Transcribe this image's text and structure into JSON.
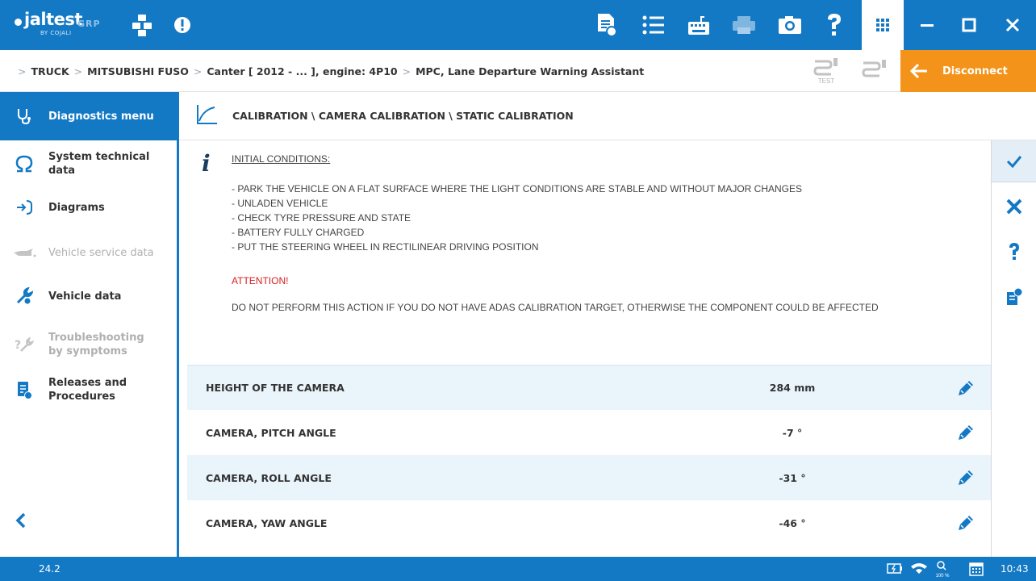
{
  "app": {
    "logo_text": "jaltest",
    "logo_sub": "BY COJALI",
    "grp_label": "GRP",
    "accent_color": "#1479c4",
    "orange_color": "#f39319"
  },
  "topbar": {
    "icons": [
      "car-group-icon",
      "alert-icon",
      "report-icon",
      "list-icon",
      "keyboard-icon",
      "printer-icon",
      "camera-icon",
      "help-icon",
      "apps-grid-icon",
      "minimize-icon",
      "maximize-icon",
      "close-icon"
    ]
  },
  "breadcrumb": {
    "items": [
      "TRUCK",
      "MITSUBISHI FUSO",
      "Canter [ 2012 - ... ], engine: 4P10",
      "MPC, Lane Departure Warning Assistant"
    ],
    "test_label": "TEST",
    "disconnect_label": "Disconnect"
  },
  "sidebar": {
    "items": [
      {
        "label": "Diagnostics menu",
        "icon": "stethoscope-icon",
        "state": "active"
      },
      {
        "label": "System technical data",
        "icon": "omega-icon",
        "state": "normal"
      },
      {
        "label": "Diagrams",
        "icon": "diagram-icon",
        "state": "normal"
      },
      {
        "label": "Vehicle service data",
        "icon": "oil-can-icon",
        "state": "disabled"
      },
      {
        "label": "Vehicle data",
        "icon": "wrench-icon",
        "state": "normal"
      },
      {
        "label": "Troubleshooting by symptoms",
        "icon": "troubleshooting-icon",
        "state": "disabled"
      },
      {
        "label": "Releases and Procedures",
        "icon": "releases-icon",
        "state": "normal"
      }
    ]
  },
  "main": {
    "title": "CALIBRATION \\ CAMERA CALIBRATION \\ STATIC CALIBRATION",
    "info": {
      "conditions_title": "INITIAL CONDITIONS:",
      "conditions": [
        "- PARK THE VEHICLE ON A FLAT SURFACE WHERE THE LIGHT CONDITIONS ARE STABLE AND WITHOUT MAJOR CHANGES",
        "- UNLADEN VEHICLE",
        "- CHECK TYRE PRESSURE AND STATE",
        "- BATTERY FULLY CHARGED",
        "- PUT THE STEERING WHEEL IN RECTILINEAR DRIVING POSITION"
      ],
      "attention_label": "ATTENTION!",
      "attention_text": "DO NOT PERFORM THIS ACTION IF YOU DO NOT HAVE ADAS CALIBRATION TARGET, OTHERWISE THE COMPONENT COULD BE AFFECTED"
    },
    "rows": [
      {
        "label": "HEIGHT OF THE CAMERA",
        "value": "284 mm"
      },
      {
        "label": "CAMERA, PITCH ANGLE",
        "value": "-7 °"
      },
      {
        "label": "CAMERA, ROLL ANGLE",
        "value": "-31 °"
      },
      {
        "label": "CAMERA, YAW ANGLE",
        "value": "-46 °"
      }
    ]
  },
  "actions": [
    "confirm-icon",
    "cancel-icon",
    "help-icon",
    "document-settings-icon"
  ],
  "statusbar": {
    "version": "24.2",
    "zoom": "100 %",
    "time": "10:43"
  }
}
